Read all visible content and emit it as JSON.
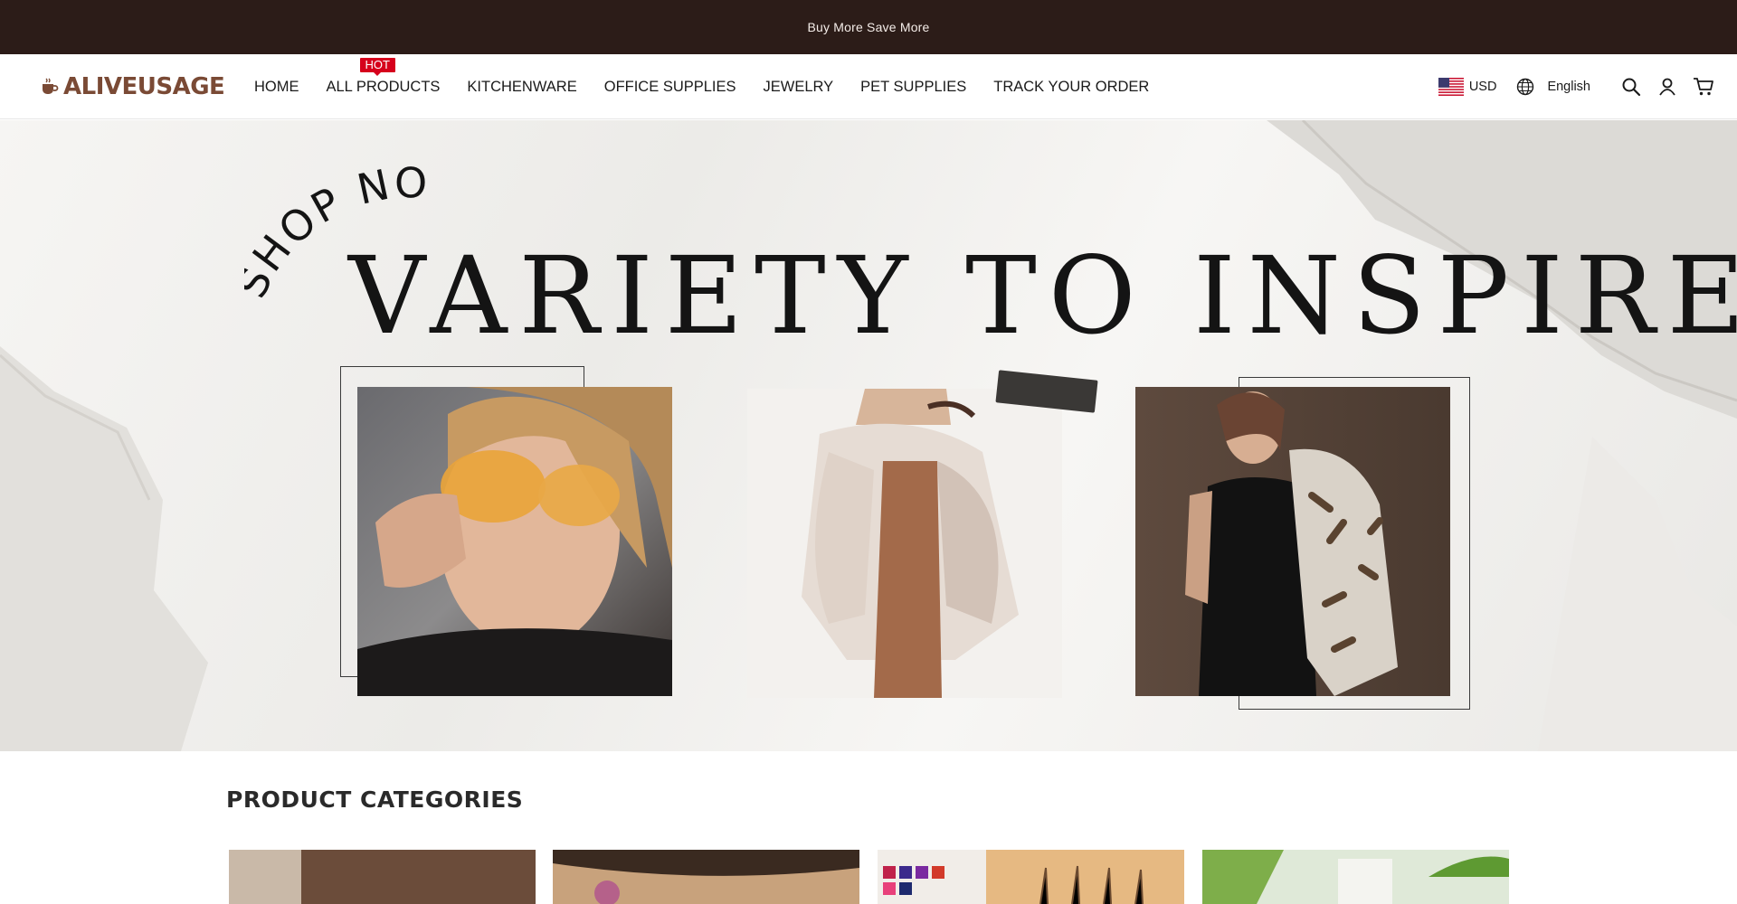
{
  "announcement": {
    "text": "Buy More Save More"
  },
  "brand": {
    "name": "ALIVEUSAGE",
    "color": "#7a4a35"
  },
  "nav": {
    "items": [
      {
        "label": "HOME"
      },
      {
        "label": "ALL PRODUCTS",
        "badge": "HOT"
      },
      {
        "label": "KITCHENWARE"
      },
      {
        "label": "OFFICE SUPPLIES"
      },
      {
        "label": "JEWELRY"
      },
      {
        "label": "PET SUPPLIES"
      },
      {
        "label": "TRACK YOUR ORDER"
      }
    ]
  },
  "tools": {
    "currency": "USD",
    "language": "English",
    "icons": [
      "globe-icon",
      "search-icon",
      "account-icon",
      "cart-icon"
    ]
  },
  "hero": {
    "script_text": "SHOP NOW",
    "title": "VARIETY TO INSPIRE"
  },
  "categories": {
    "title": "PRODUCT CATEGORIES"
  },
  "colors": {
    "announcement_bg": "#2c1c18",
    "hot_badge": "#d6001c",
    "text": "#1a1a1a"
  }
}
